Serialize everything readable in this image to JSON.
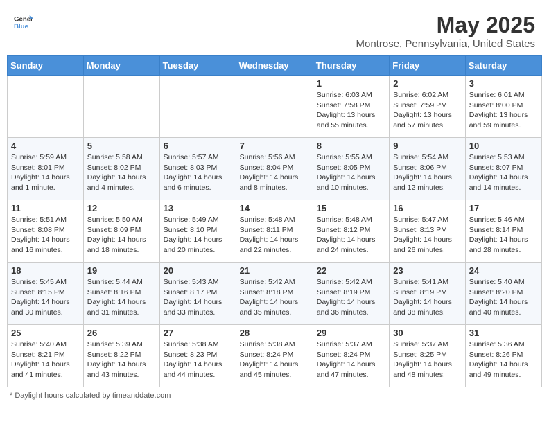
{
  "header": {
    "logo_general": "General",
    "logo_blue": "Blue",
    "month_title": "May 2025",
    "location": "Montrose, Pennsylvania, United States"
  },
  "weekdays": [
    "Sunday",
    "Monday",
    "Tuesday",
    "Wednesday",
    "Thursday",
    "Friday",
    "Saturday"
  ],
  "footer": {
    "note": "Daylight hours"
  },
  "weeks": [
    [
      {
        "day": "",
        "info": ""
      },
      {
        "day": "",
        "info": ""
      },
      {
        "day": "",
        "info": ""
      },
      {
        "day": "",
        "info": ""
      },
      {
        "day": "1",
        "info": "Sunrise: 6:03 AM\nSunset: 7:58 PM\nDaylight: 13 hours\nand 55 minutes."
      },
      {
        "day": "2",
        "info": "Sunrise: 6:02 AM\nSunset: 7:59 PM\nDaylight: 13 hours\nand 57 minutes."
      },
      {
        "day": "3",
        "info": "Sunrise: 6:01 AM\nSunset: 8:00 PM\nDaylight: 13 hours\nand 59 minutes."
      }
    ],
    [
      {
        "day": "4",
        "info": "Sunrise: 5:59 AM\nSunset: 8:01 PM\nDaylight: 14 hours\nand 1 minute."
      },
      {
        "day": "5",
        "info": "Sunrise: 5:58 AM\nSunset: 8:02 PM\nDaylight: 14 hours\nand 4 minutes."
      },
      {
        "day": "6",
        "info": "Sunrise: 5:57 AM\nSunset: 8:03 PM\nDaylight: 14 hours\nand 6 minutes."
      },
      {
        "day": "7",
        "info": "Sunrise: 5:56 AM\nSunset: 8:04 PM\nDaylight: 14 hours\nand 8 minutes."
      },
      {
        "day": "8",
        "info": "Sunrise: 5:55 AM\nSunset: 8:05 PM\nDaylight: 14 hours\nand 10 minutes."
      },
      {
        "day": "9",
        "info": "Sunrise: 5:54 AM\nSunset: 8:06 PM\nDaylight: 14 hours\nand 12 minutes."
      },
      {
        "day": "10",
        "info": "Sunrise: 5:53 AM\nSunset: 8:07 PM\nDaylight: 14 hours\nand 14 minutes."
      }
    ],
    [
      {
        "day": "11",
        "info": "Sunrise: 5:51 AM\nSunset: 8:08 PM\nDaylight: 14 hours\nand 16 minutes."
      },
      {
        "day": "12",
        "info": "Sunrise: 5:50 AM\nSunset: 8:09 PM\nDaylight: 14 hours\nand 18 minutes."
      },
      {
        "day": "13",
        "info": "Sunrise: 5:49 AM\nSunset: 8:10 PM\nDaylight: 14 hours\nand 20 minutes."
      },
      {
        "day": "14",
        "info": "Sunrise: 5:48 AM\nSunset: 8:11 PM\nDaylight: 14 hours\nand 22 minutes."
      },
      {
        "day": "15",
        "info": "Sunrise: 5:48 AM\nSunset: 8:12 PM\nDaylight: 14 hours\nand 24 minutes."
      },
      {
        "day": "16",
        "info": "Sunrise: 5:47 AM\nSunset: 8:13 PM\nDaylight: 14 hours\nand 26 minutes."
      },
      {
        "day": "17",
        "info": "Sunrise: 5:46 AM\nSunset: 8:14 PM\nDaylight: 14 hours\nand 28 minutes."
      }
    ],
    [
      {
        "day": "18",
        "info": "Sunrise: 5:45 AM\nSunset: 8:15 PM\nDaylight: 14 hours\nand 30 minutes."
      },
      {
        "day": "19",
        "info": "Sunrise: 5:44 AM\nSunset: 8:16 PM\nDaylight: 14 hours\nand 31 minutes."
      },
      {
        "day": "20",
        "info": "Sunrise: 5:43 AM\nSunset: 8:17 PM\nDaylight: 14 hours\nand 33 minutes."
      },
      {
        "day": "21",
        "info": "Sunrise: 5:42 AM\nSunset: 8:18 PM\nDaylight: 14 hours\nand 35 minutes."
      },
      {
        "day": "22",
        "info": "Sunrise: 5:42 AM\nSunset: 8:19 PM\nDaylight: 14 hours\nand 36 minutes."
      },
      {
        "day": "23",
        "info": "Sunrise: 5:41 AM\nSunset: 8:19 PM\nDaylight: 14 hours\nand 38 minutes."
      },
      {
        "day": "24",
        "info": "Sunrise: 5:40 AM\nSunset: 8:20 PM\nDaylight: 14 hours\nand 40 minutes."
      }
    ],
    [
      {
        "day": "25",
        "info": "Sunrise: 5:40 AM\nSunset: 8:21 PM\nDaylight: 14 hours\nand 41 minutes."
      },
      {
        "day": "26",
        "info": "Sunrise: 5:39 AM\nSunset: 8:22 PM\nDaylight: 14 hours\nand 43 minutes."
      },
      {
        "day": "27",
        "info": "Sunrise: 5:38 AM\nSunset: 8:23 PM\nDaylight: 14 hours\nand 44 minutes."
      },
      {
        "day": "28",
        "info": "Sunrise: 5:38 AM\nSunset: 8:24 PM\nDaylight: 14 hours\nand 45 minutes."
      },
      {
        "day": "29",
        "info": "Sunrise: 5:37 AM\nSunset: 8:24 PM\nDaylight: 14 hours\nand 47 minutes."
      },
      {
        "day": "30",
        "info": "Sunrise: 5:37 AM\nSunset: 8:25 PM\nDaylight: 14 hours\nand 48 minutes."
      },
      {
        "day": "31",
        "info": "Sunrise: 5:36 AM\nSunset: 8:26 PM\nDaylight: 14 hours\nand 49 minutes."
      }
    ]
  ]
}
